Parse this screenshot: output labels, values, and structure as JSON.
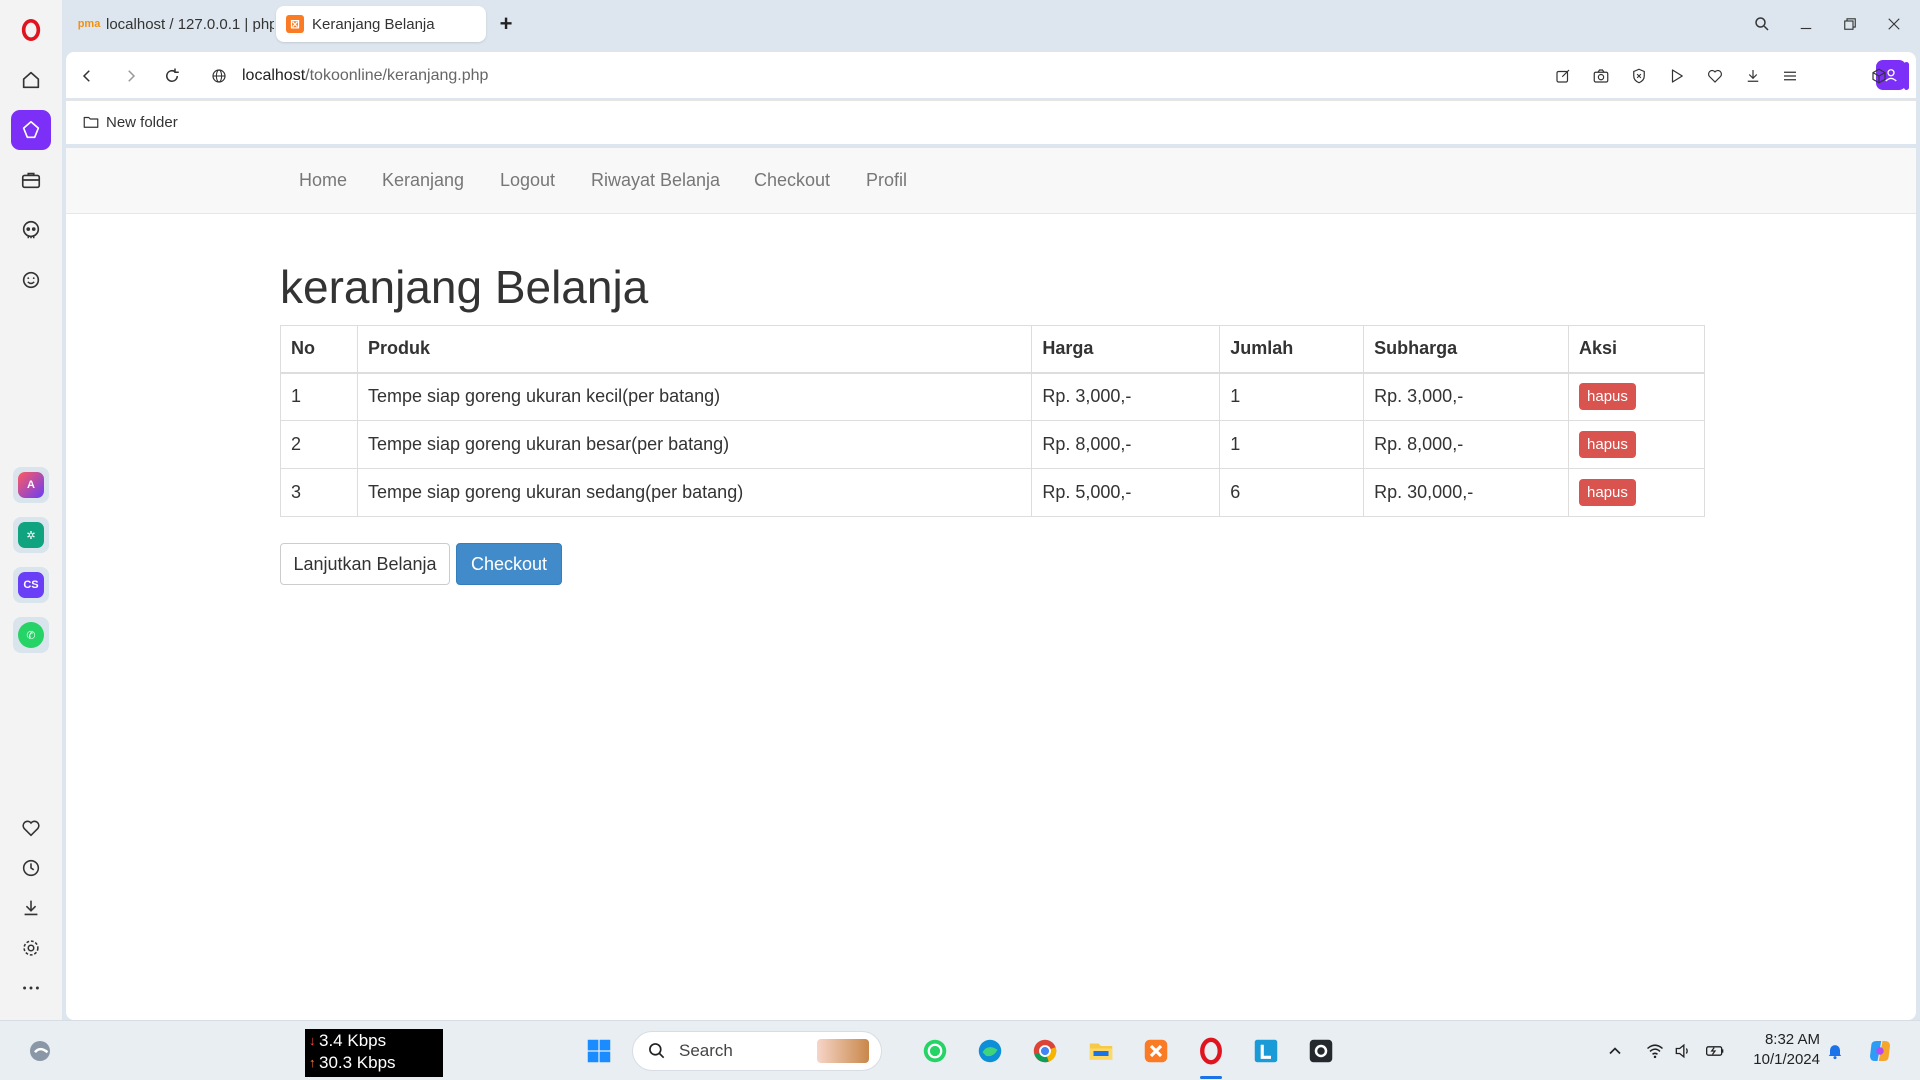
{
  "browser": {
    "tabs": [
      {
        "title": "localhost / 127.0.0.1 | php",
        "active": false
      },
      {
        "title": "Keranjang Belanja",
        "active": true
      }
    ],
    "url_host": "localhost",
    "url_path": "/tokoonline/keranjang.php",
    "bookmarks": [
      "New folder"
    ]
  },
  "site": {
    "nav": [
      "Home",
      "Keranjang",
      "Logout",
      "Riwayat Belanja",
      "Checkout",
      "Profil"
    ],
    "heading": "keranjang Belanja",
    "table": {
      "headers": [
        "No",
        "Produk",
        "Harga",
        "Jumlah",
        "Subharga",
        "Aksi"
      ],
      "rows": [
        {
          "no": "1",
          "produk": "Tempe siap goreng ukuran kecil(per batang)",
          "harga": "Rp. 3,000,-",
          "jumlah": "1",
          "subharga": "Rp. 3,000,-",
          "aksi": "hapus"
        },
        {
          "no": "2",
          "produk": "Tempe siap goreng ukuran besar(per batang)",
          "harga": "Rp. 8,000,-",
          "jumlah": "1",
          "subharga": "Rp. 8,000,-",
          "aksi": "hapus"
        },
        {
          "no": "3",
          "produk": "Tempe siap goreng ukuran sedang(per batang)",
          "harga": "Rp. 5,000,-",
          "jumlah": "6",
          "subharga": "Rp. 30,000,-",
          "aksi": "hapus"
        }
      ]
    },
    "buttons": {
      "continue": "Lanjutkan Belanja",
      "checkout": "Checkout"
    }
  },
  "taskbar": {
    "net_down": "3.4 Kbps",
    "net_up": "30.3 Kbps",
    "search_label": "Search",
    "time": "8:32 AM",
    "date": "10/1/2024"
  },
  "colors": {
    "accent_purple": "#7b2ff7",
    "danger": "#d9534f",
    "primary": "#428bca",
    "opera_red": "#e0141e"
  }
}
